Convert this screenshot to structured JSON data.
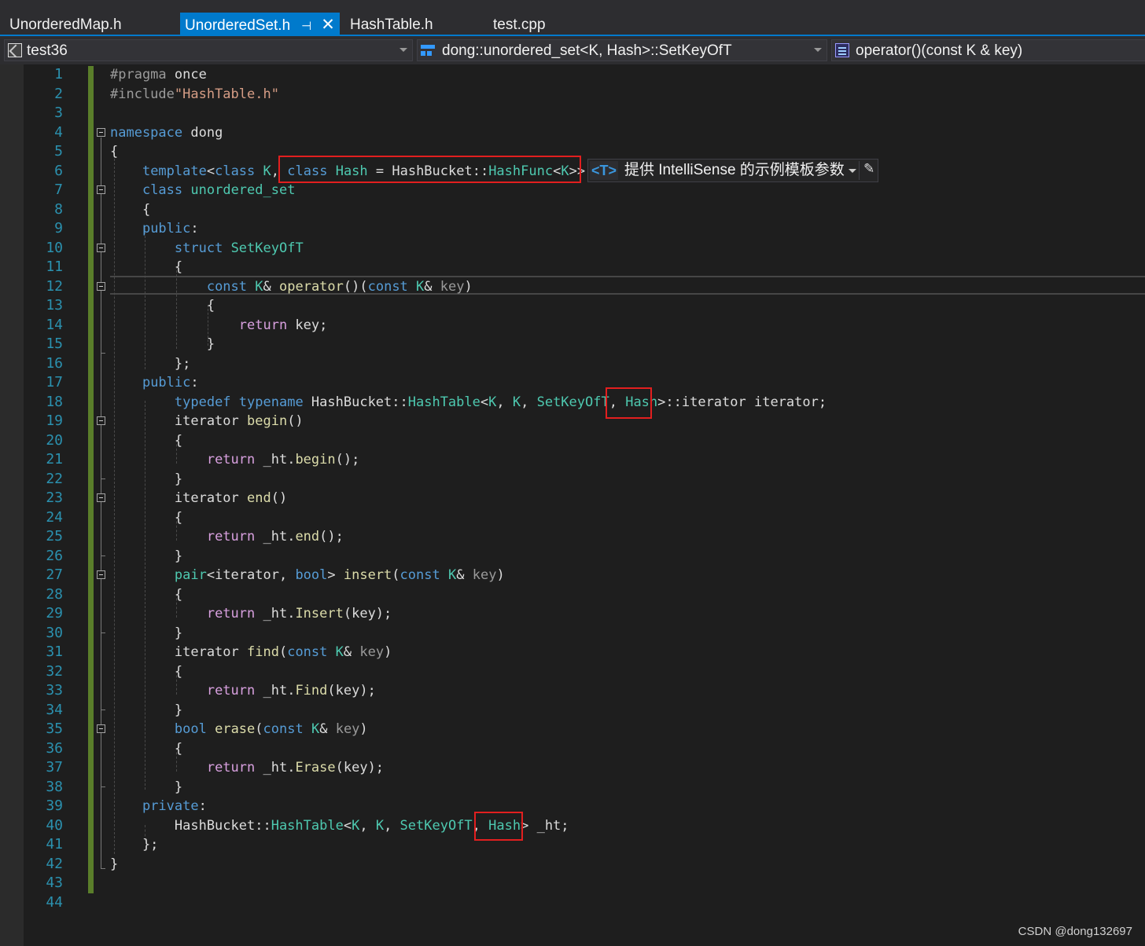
{
  "tabs": [
    {
      "label": "UnorderedMap.h"
    },
    {
      "label": "UnorderedSet.h",
      "active": true
    },
    {
      "label": "HashTable.h"
    },
    {
      "label": "test.cpp"
    }
  ],
  "tab_icons": {
    "pin": "⊣",
    "close": "✕"
  },
  "nav": {
    "project": "test36",
    "scope": "dong::unordered_set<K, Hash>::SetKeyOfT",
    "member": "operator()(const K & key)"
  },
  "line_numbers": [
    "1",
    "2",
    "3",
    "4",
    "5",
    "6",
    "7",
    "8",
    "9",
    "10",
    "11",
    "12",
    "13",
    "14",
    "15",
    "16",
    "17",
    "18",
    "19",
    "20",
    "21",
    "22",
    "23",
    "24",
    "25",
    "26",
    "27",
    "28",
    "29",
    "30",
    "31",
    "32",
    "33",
    "34",
    "35",
    "36",
    "37",
    "38",
    "39",
    "40",
    "41",
    "42",
    "43",
    "44"
  ],
  "code_lines": [
    "#pragma once",
    "#include\"HashTable.h\"",
    "",
    "namespace dong",
    "{",
    "    template<class K, class Hash = HashBucket::HashFunc<K>>",
    "    class unordered_set",
    "    {",
    "    public:",
    "        struct SetKeyOfT",
    "        {",
    "            const K& operator()(const K& key)",
    "            {",
    "                return key;",
    "            }",
    "        };",
    "    public:",
    "        typedef typename HashBucket::HashTable<K, K, SetKeyOfT, Hash>::iterator iterator;",
    "        iterator begin()",
    "        {",
    "            return _ht.begin();",
    "        }",
    "        iterator end()",
    "        {",
    "            return _ht.end();",
    "        }",
    "        pair<iterator, bool> insert(const K& key)",
    "        {",
    "            return _ht.Insert(key);",
    "        }",
    "        iterator find(const K& key)",
    "        {",
    "            return _ht.Find(key);",
    "        }",
    "        bool erase(const K& key)",
    "        {",
    "            return _ht.Erase(key);",
    "        }",
    "    private:",
    "        HashBucket::HashTable<K, K, SetKeyOfT, Hash> _ht;",
    "    };",
    "}",
    "",
    ""
  ],
  "intellisense": {
    "tag": "<T>",
    "text": "提供 IntelliSense 的示例模板参数"
  },
  "watermark": "CSDN @dong132697",
  "colors": {
    "accent": "#007acc",
    "line_number": "#2b91af",
    "keyword": "#569cd6",
    "type": "#4ec9b0",
    "highlight_box": "#e21f1f",
    "change_bar": "#5a7e2a"
  }
}
